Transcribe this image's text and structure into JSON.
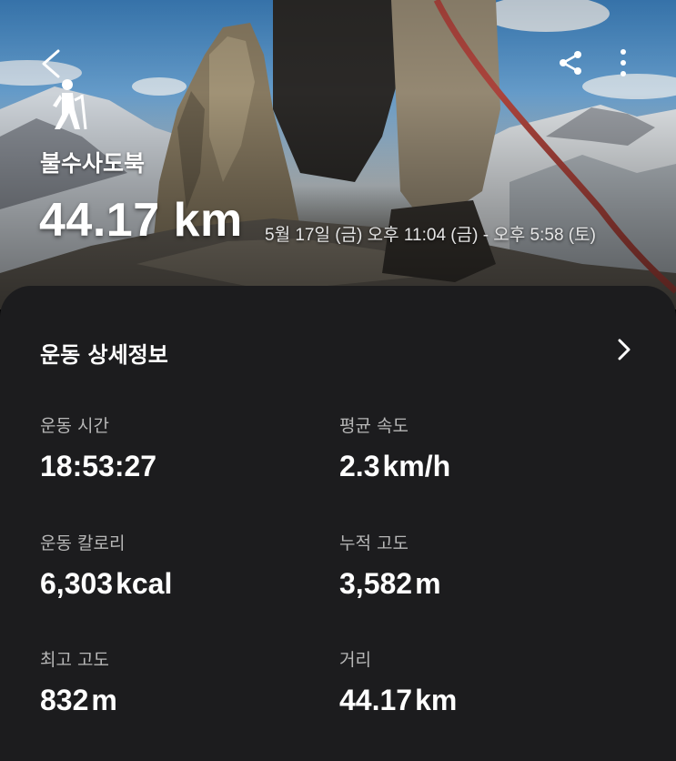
{
  "header": {
    "activity_name": "불수사도북",
    "distance": "44.17 km",
    "date_range": "5월 17일 (금) 오후 11:04 (금) - 오후 5:58 (토)",
    "icons": [
      "back-icon",
      "share-icon",
      "more-icon",
      "hiking-icon"
    ]
  },
  "details": {
    "title": "운동 상세정보",
    "stats": [
      {
        "label": "운동 시간",
        "value": "18:53:27",
        "unit": ""
      },
      {
        "label": "평균 속도",
        "value": "2.3",
        "unit": "km/h"
      },
      {
        "label": "운동 칼로리",
        "value": "6,303",
        "unit": "kcal"
      },
      {
        "label": "누적 고도",
        "value": "3,582",
        "unit": "m"
      },
      {
        "label": "최고 고도",
        "value": "832",
        "unit": "m"
      },
      {
        "label": "거리",
        "value": "44.17",
        "unit": "km"
      }
    ]
  },
  "colors": {
    "card_bg": "#1c1c1e",
    "label": "#b7b7b7",
    "text": "#ffffff"
  }
}
